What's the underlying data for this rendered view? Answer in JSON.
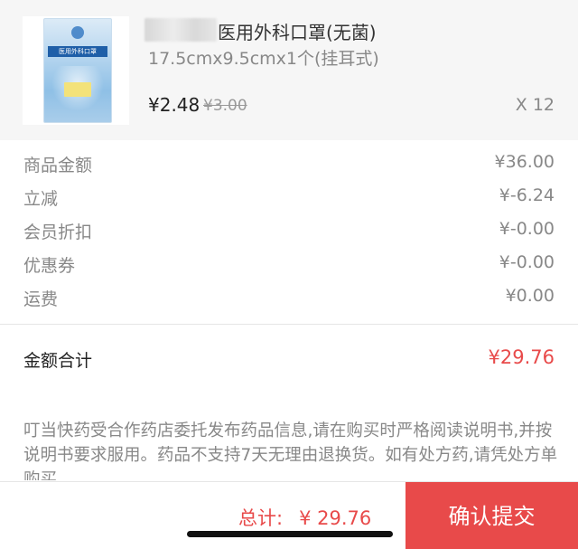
{
  "product": {
    "name": "医用外科口罩(无菌)",
    "spec": "17.5cmx9.5cmx1个(挂耳式)",
    "price": "¥2.48",
    "original_price": "¥3.00",
    "quantity": "X 12",
    "image_label": "医用外科口罩"
  },
  "summary": {
    "rows": [
      {
        "label": "商品金额",
        "value": "¥36.00"
      },
      {
        "label": "立减",
        "value": "¥-6.24"
      },
      {
        "label": "会员折扣",
        "value": "¥-0.00"
      },
      {
        "label": "优惠券",
        "value": "¥-0.00"
      },
      {
        "label": "运费",
        "value": "¥0.00"
      }
    ],
    "total_label": "金额合计",
    "total_value": "¥29.76"
  },
  "notice": "叮当快药受合作药店委托发布药品信息,请在购买时严格阅读说明书,并按说明书要求服用。药品不支持7天无理由退换货。如有处方药,请凭处方单购买。",
  "footer": {
    "total_label": "总计:",
    "total_value": "¥ 29.76",
    "confirm_label": "确认提交"
  },
  "colors": {
    "accent": "#e84a4a",
    "product_bg": "#f6f6f6",
    "muted_text": "#888888"
  }
}
